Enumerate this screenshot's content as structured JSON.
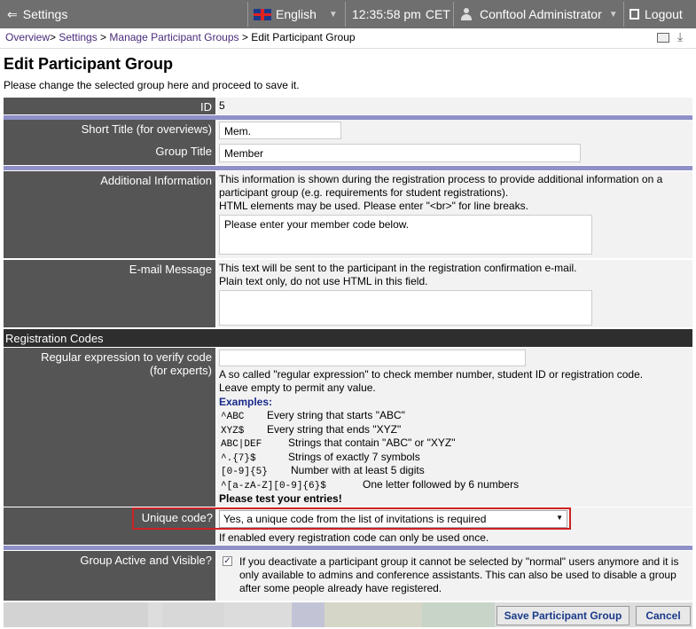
{
  "topbar": {
    "settings_label": "Settings",
    "language": "English",
    "time": "12:35:58 pm",
    "timezone": "CET",
    "user": "Conftool Administrator",
    "logout_label": "Logout"
  },
  "breadcrumb": {
    "items": [
      "Overview",
      "Settings",
      "Manage Participant Groups"
    ],
    "current": "Edit Participant Group"
  },
  "page": {
    "title": "Edit Participant Group",
    "subtitle": "Please change the selected group here and proceed to save it."
  },
  "form": {
    "id_label": "ID",
    "id_value": "5",
    "short_title_label": "Short Title (for overviews)",
    "short_title_value": "Mem.",
    "group_title_label": "Group Title",
    "group_title_value": "Member",
    "additional_info_label": "Additional Information",
    "additional_info_help1": "This information is shown during the registration process to provide additional information on a participant group (e.g. requirements for student registrations).",
    "additional_info_help2": "HTML elements may be used. Please enter \"<br>\" for line breaks.",
    "additional_info_value": "Please enter your member code below.",
    "email_label": "E-mail Message",
    "email_help1": "This text will be sent to the participant in the registration confirmation e-mail.",
    "email_help2": "Plain text only, do not use HTML in this field.",
    "email_value": "",
    "section_registration": "Registration Codes",
    "regex_label_1": "Regular expression to verify code",
    "regex_label_2": "(for experts)",
    "regex_value": "",
    "regex_help1": "A so called \"regular expression\" to check member number, student ID or registration code.",
    "regex_help2": "Leave empty to permit any value.",
    "examples_heading": "Examples:",
    "examples": [
      {
        "code": "^ABC",
        "desc": "Every string that starts \"ABC\""
      },
      {
        "code": "XYZ$",
        "desc": "Every string that ends \"XYZ\""
      },
      {
        "code": "ABC|DEF",
        "desc": "Strings that contain \"ABC\" or \"XYZ\""
      },
      {
        "code": "^.{7}$",
        "desc": "Strings of exactly 7 symbols"
      },
      {
        "code": "[0-9]{5}",
        "desc": "Number with at least 5 digits"
      },
      {
        "code": "^[a-zA-Z][0-9]{6}$",
        "desc": "One letter followed by 6 numbers"
      }
    ],
    "test_note": "Please test your entries!",
    "unique_label": "Unique code?",
    "unique_value": "Yes, a unique code from the list of invitations is required",
    "unique_help": "If enabled every registration code can only be used once.",
    "active_label": "Group Active and Visible?",
    "active_checked": true,
    "active_help": "If you deactivate a participant group it cannot be selected by \"normal\" users anymore and it is only available to admins and conference assistants. This can also be used to disable a group after some people already have registered."
  },
  "buttons": {
    "save": "Save Participant Group",
    "cancel": "Cancel"
  },
  "colors": {
    "label_bg": "#555555",
    "divider": "#9090c8",
    "highlight": "#cc2222",
    "link": "#4a2b7a"
  }
}
